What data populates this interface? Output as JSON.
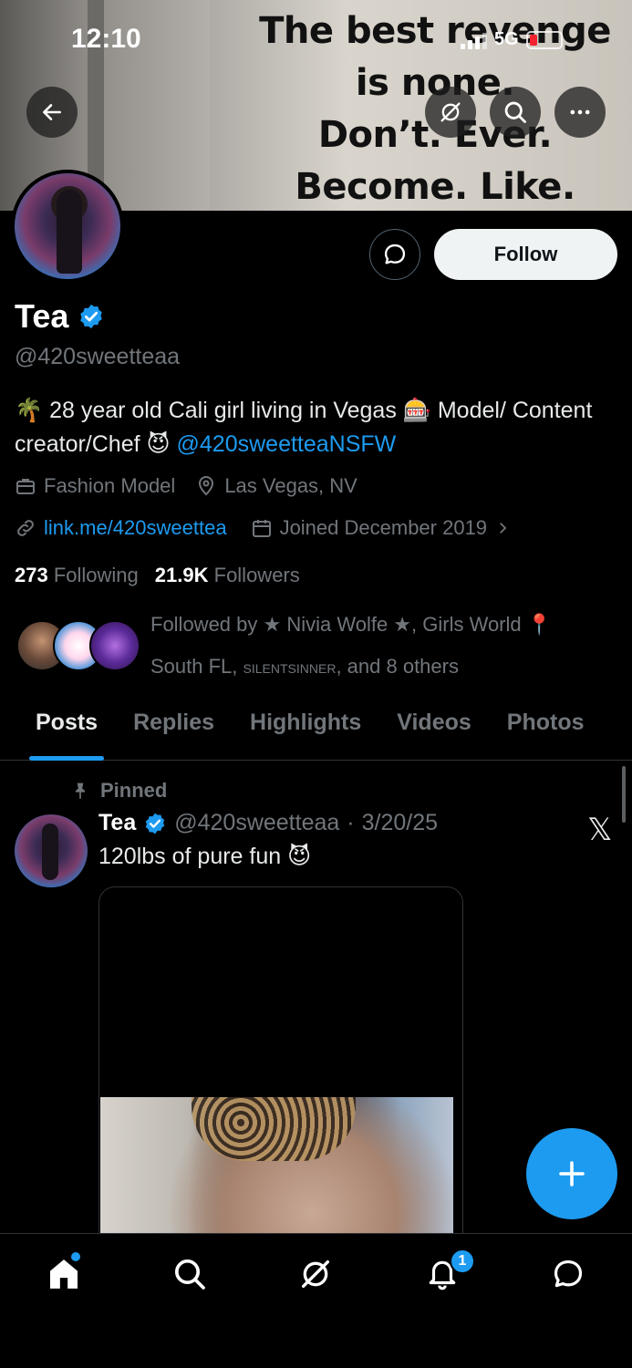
{
  "status_bar": {
    "time": "12:10",
    "network": "5G"
  },
  "banner": {
    "lines": [
      "The best revenge",
      "is none.",
      "Don’t. Ever.",
      "Become. Like. Them"
    ]
  },
  "header_actions": [
    "back-arrow-icon",
    "grok-icon",
    "search-icon",
    "more-icon"
  ],
  "profile": {
    "name": "Tea",
    "handle": "@420sweetteaa",
    "verified": true,
    "bio_part1": "🌴 28 year old Cali girl living in Vegas 🎰 Model/ Content creator/Chef 😈 ",
    "bio_link": "@420sweetteaNSFW",
    "category": "Fashion Model",
    "location": "Las Vegas, NV",
    "website": "link.me/420sweettea",
    "joined": "Joined December 2019",
    "following_count": "273",
    "following_label": "Following",
    "followers_count": "21.9K",
    "followers_label": "Followers",
    "followed_by_part1": "Followed by ★ Nivia Wolfe ★, Girls World 📍 South FL, ",
    "followed_by_smallcaps": "silentsinner",
    "followed_by_part2": ", and 8 others",
    "follow_button": "Follow"
  },
  "tabs": [
    "Posts",
    "Replies",
    "Highlights",
    "Videos",
    "Photos"
  ],
  "active_tab": "Posts",
  "post": {
    "pinned_label": "Pinned",
    "author": "Tea",
    "handle": "@420sweetteaa",
    "date": "3/20/25",
    "separator": "·",
    "text": "120lbs of pure fun 😈"
  },
  "bottom_nav": {
    "items": [
      "home-icon",
      "search-icon",
      "grok-icon",
      "notifications-icon",
      "messages-icon"
    ],
    "notification_count": "1"
  },
  "colors": {
    "accent": "#1d9bf0",
    "background": "#000000",
    "muted": "#71767b",
    "text": "#e7e9ea"
  }
}
